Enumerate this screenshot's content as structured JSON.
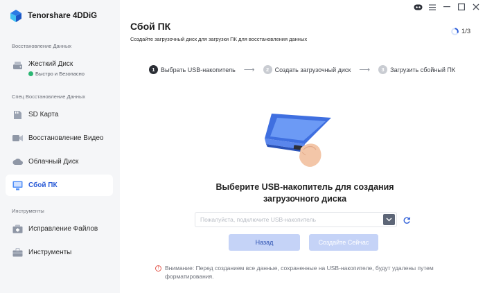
{
  "app": {
    "title": "Tenorshare 4DDiG"
  },
  "sidebar": {
    "sections": [
      {
        "label": "Восстановление Данных"
      },
      {
        "label": "Спец Восстановление Данных"
      },
      {
        "label": "Инструменты"
      }
    ],
    "items": [
      {
        "label": "Жесткий Диск",
        "sub": "Быстро и Безопасно",
        "icon": "hard-drive-icon"
      },
      {
        "label": "SD Карта",
        "icon": "sd-card-icon"
      },
      {
        "label": "Восстановление Видео",
        "icon": "video-icon"
      },
      {
        "label": "Облачный Диск",
        "icon": "cloud-icon"
      },
      {
        "label": "Сбой ПК",
        "icon": "crashed-pc-icon",
        "active": true
      },
      {
        "label": "Исправление Файлов",
        "icon": "file-repair-icon"
      },
      {
        "label": "Инструменты",
        "icon": "toolbox-icon"
      }
    ]
  },
  "header": {
    "title": "Сбой ПК",
    "subtitle": "Создайте загрузочный диск для загрузки ПК для восстановления данных",
    "step_counter": "1/3"
  },
  "steps": [
    {
      "num": "1",
      "label": "Выбрать USB-накопитель",
      "active": true
    },
    {
      "num": "2",
      "label": "Создать загрузочный диск",
      "active": false
    },
    {
      "num": "3",
      "label": "Загрузить сбойный ПК",
      "active": false
    }
  ],
  "main": {
    "prompt_line1": "Выберите USB-накопитель для создания",
    "prompt_line2": "загрузочного диска",
    "usb_placeholder": "Пожалуйста, подключите USB-накопитель",
    "back_label": "Назад",
    "create_label": "Создайте Сейчас",
    "warning_line1": "Внимание: Перед созданием все данные, сохраненные на USB-накопителе, будут удалены путем",
    "warning_line2": "форматирования."
  },
  "colors": {
    "accent": "#2a5bd7",
    "button_bg": "#c5d3f7",
    "warning": "#e45a4f"
  }
}
